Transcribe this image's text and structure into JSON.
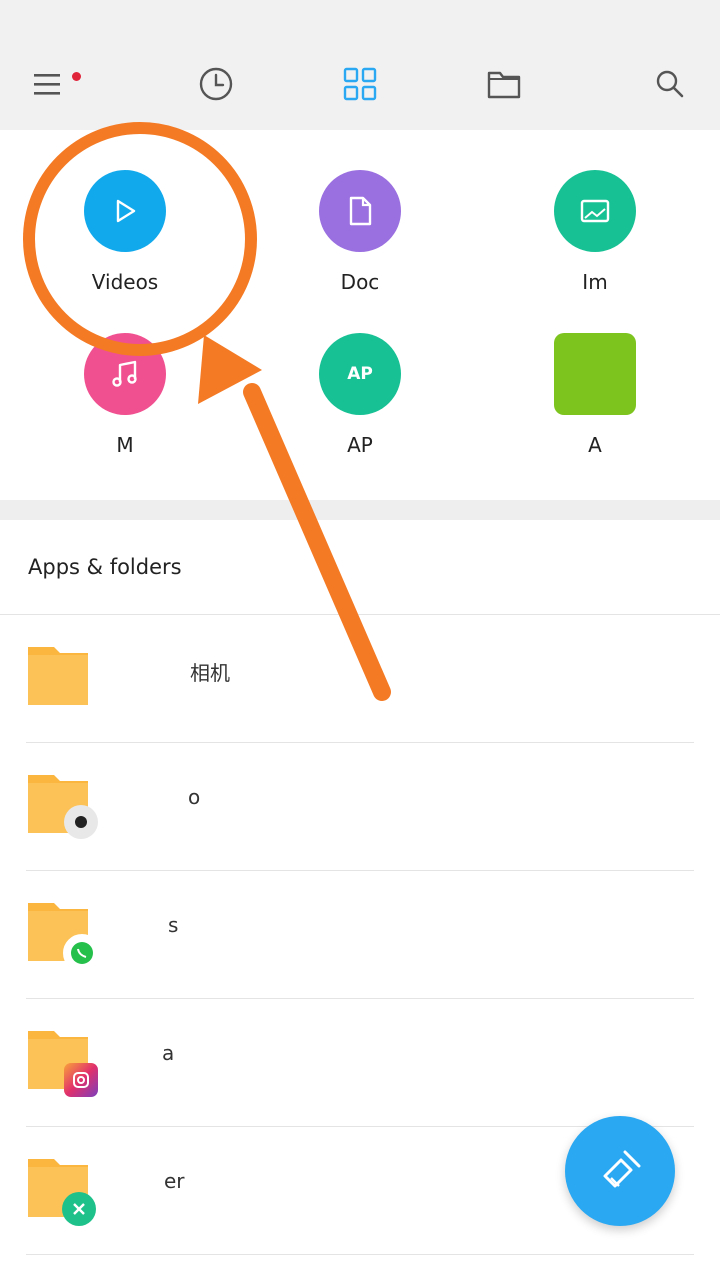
{
  "toolbar": {
    "icons": [
      "menu-icon",
      "recent-clock-icon",
      "categories-grid-icon",
      "folder-icon",
      "search-icon"
    ],
    "accent": "#2aa8f2",
    "notification_dot_color": "#e0243a"
  },
  "categories": [
    {
      "label": "Videos",
      "color": "#12a9ec",
      "icon": "play-icon"
    },
    {
      "label": "Doc",
      "color": "#9a6fe0",
      "icon": "document-icon"
    },
    {
      "label": "Im",
      "color": "#17c194",
      "icon": "image-icon"
    },
    {
      "label": "M",
      "color": "#f0508f",
      "icon": "music-icon"
    },
    {
      "label": "AP",
      "color": "#17c194",
      "icon": "apk-icon",
      "icon_text": "AP"
    },
    {
      "label": "A",
      "color": "#7dc41e",
      "icon": "archive-icon"
    }
  ],
  "section": {
    "title": "Apps & folders"
  },
  "folders": [
    {
      "name": "相机",
      "badge": "none"
    },
    {
      "name": "o",
      "badge": "camera-icon"
    },
    {
      "name": "s",
      "badge": "whatsapp-icon"
    },
    {
      "name": "a",
      "badge": "instagram-icon"
    },
    {
      "name": "er",
      "badge": "clean-icon"
    }
  ],
  "fab": {
    "icon": "brush-icon"
  },
  "annotation": {
    "color": "#f47a24"
  }
}
